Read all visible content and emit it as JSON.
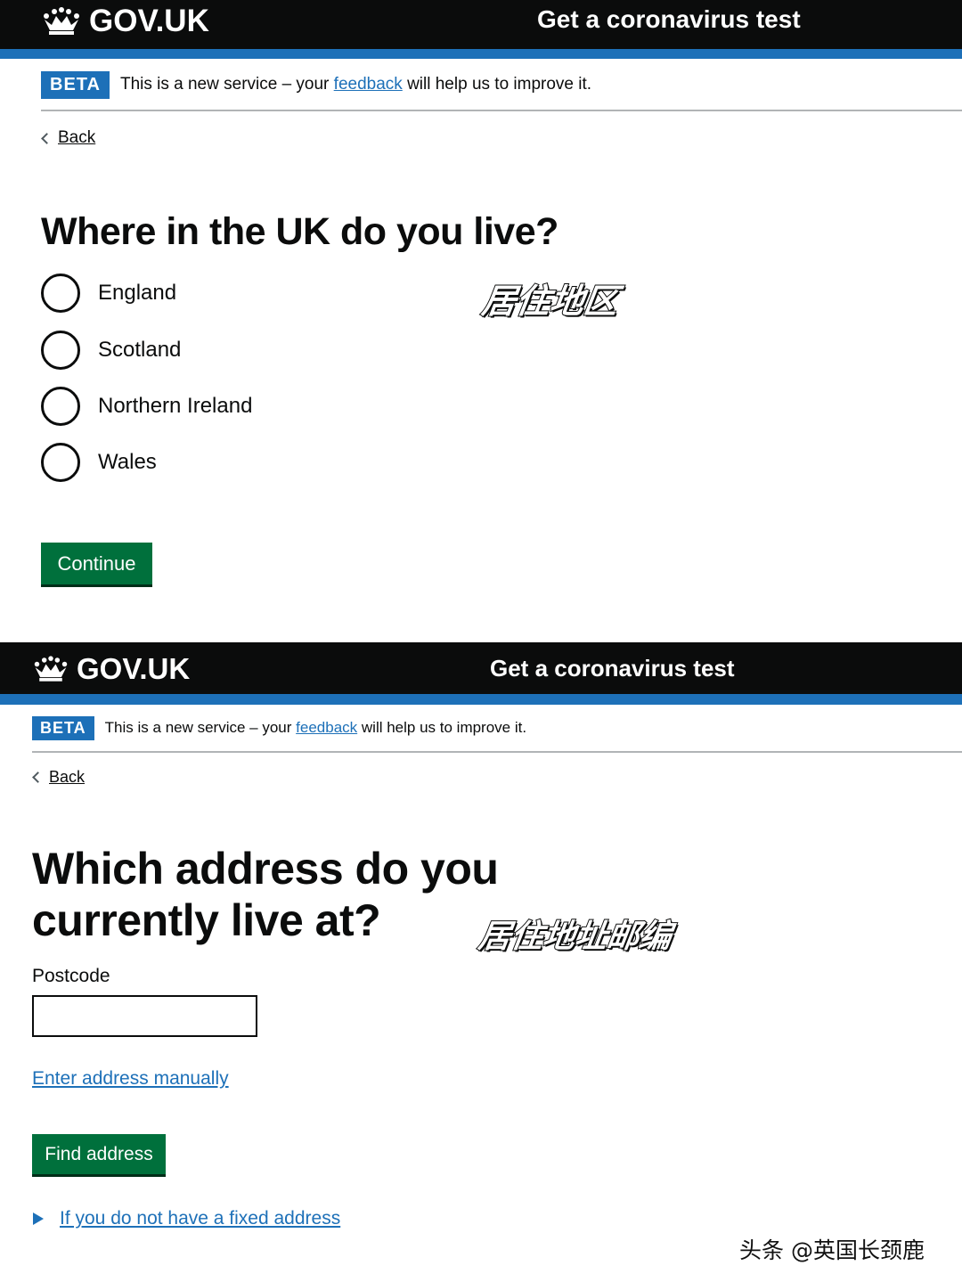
{
  "screens": [
    {
      "header": {
        "logo_text": "GOV.UK",
        "logo_icon": "crown-icon",
        "service_name": "Get a coronavirus test"
      },
      "phase_banner": {
        "tag": "BETA",
        "text_before": "This is a new service – your",
        "link_text": "feedback",
        "text_after": "will help us to improve it."
      },
      "back_link": "Back",
      "heading": "Where in the UK do you live?",
      "annotation": "居住地区",
      "radio_options": [
        "England",
        "Scotland",
        "Northern Ireland",
        "Wales"
      ],
      "button_label": "Continue"
    },
    {
      "header": {
        "logo_text": "GOV.UK",
        "logo_icon": "crown-icon",
        "service_name": "Get a coronavirus test"
      },
      "phase_banner": {
        "tag": "BETA",
        "text_before": "This is a new service – your",
        "link_text": "feedback",
        "text_after": "will help us to improve it."
      },
      "back_link": "Back",
      "heading_line1": "Which address do you",
      "heading_line2": "currently live at?",
      "annotation": "居住地址邮编",
      "postcode": {
        "label": "Postcode",
        "value": "",
        "placeholder": ""
      },
      "manual_link": "Enter address manually",
      "button_label": "Find address",
      "details_summary": "If you do not have a fixed address"
    }
  ],
  "watermark": "头条 @英国长颈鹿",
  "colors": {
    "header_bg": "#0b0c0c",
    "brand_blue": "#1d70b8",
    "button_green": "#00703c"
  }
}
